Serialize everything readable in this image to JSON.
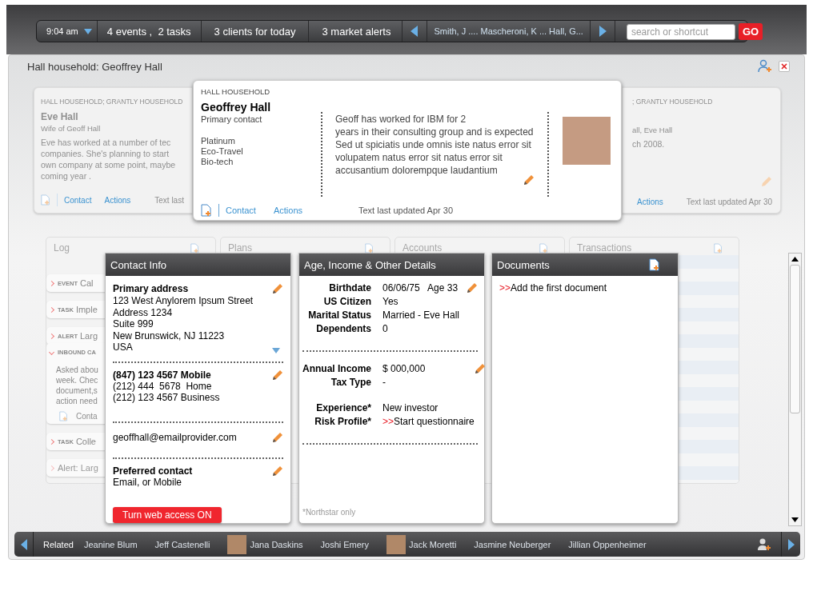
{
  "top_bar": {
    "time": "9:04 am",
    "items": [
      "4 events ,  2 tasks",
      "3 clients for today",
      "3 market alerts"
    ],
    "recent": "Smith, J .... Mascheroni, K ... Hall, G...",
    "search": {
      "placeholder": "search or shortcut"
    },
    "go": "GO"
  },
  "window": {
    "title": "Hall household: Geoffrey Hall"
  },
  "cards": [
    {
      "kind": "faded",
      "household": "HALL HOUSEHOLD; GRANTLY HOUSEHOLD",
      "name": "Eve Hall",
      "role": "Wife of Geoff Hall",
      "note": [
        "Eve has worked at a number of tec",
        "companies. She's planning to start",
        "own company at some point, maybe",
        "coming year ."
      ],
      "links": [
        "Contact",
        "Actions"
      ],
      "updated": "Text last"
    },
    {
      "kind": "focused",
      "household": "HALL HOUSEHOLD",
      "name": "Geoffrey Hall",
      "role": "Primary contact",
      "tags": [
        "Platinum",
        "Eco-Travel",
        "Bio-tech"
      ],
      "note": [
        "Geoff has worked for IBM for 2",
        "years in their consulting group and is expected",
        "Sed ut spiciatis unde omnis iste natus error sit",
        "volupatem natus error sit natus error sit",
        "accusantium dolorempque laudantium"
      ],
      "links": [
        "Contact",
        "Actions"
      ],
      "updated": "Text last updated Apr 30"
    },
    {
      "kind": "faded",
      "household": "; GRANTLY HOUSEHOLD",
      "role": "all, Eve Hall",
      "note": [
        "ch 2008."
      ],
      "links": [
        "Actions"
      ],
      "updated": "Text last updated Apr 30"
    }
  ],
  "panels": [
    {
      "title": "Log"
    },
    {
      "title": "Plans"
    },
    {
      "title": "Accounts"
    },
    {
      "title": "Transactions"
    }
  ],
  "log_items": [
    {
      "type": "EVENT",
      "text": "Cal",
      "expanded": false
    },
    {
      "type": "TASK",
      "text": "Imple",
      "expanded": false
    },
    {
      "type": "ALERT",
      "text": "Larg",
      "expanded": false
    },
    {
      "type": "INBOUND CA",
      "expanded": true,
      "body": [
        "Asked abou",
        "week. Chec",
        "document,s",
        "action need"
      ],
      "link": "Conta"
    },
    {
      "type": "TASK",
      "text": "Colle",
      "expanded": false
    },
    {
      "text": "Alert: Larg",
      "expanded": false
    }
  ],
  "contact_info": {
    "title": "Contact Info",
    "sections": [
      {
        "heading": "Primary address",
        "lines": [
          "123 West Anylorem Ipsum Street",
          "Address 1234",
          "Suite 999",
          "New Brunswick, NJ 11223",
          "USA"
        ],
        "kind": "address"
      },
      {
        "heading": "(847) 123 4567 Mobile",
        "lines": [
          "(212) 444  5678  Home",
          "(212) 123 4567 Business"
        ],
        "kind": "plain"
      },
      {
        "lines": [
          "geoffhall@emailprovider.com"
        ],
        "kind": "plain"
      },
      {
        "heading": "Preferred contact",
        "lines": [
          "Email, or Mobile"
        ],
        "kind": "plain"
      }
    ],
    "button": "Turn web access ON"
  },
  "details": {
    "title": "Age, Income & Other Details",
    "groups": [
      {
        "blocks": [
          [
            {
              "label": "Birthdate",
              "value": "06/06/75   Age 33"
            },
            {
              "label": "US Citizen",
              "value": "Yes"
            },
            {
              "label": "Marital Status",
              "value": "Married - Eve Hall"
            },
            {
              "label": "Dependents",
              "value": "0"
            }
          ]
        ]
      },
      {
        "blocks": [
          [
            {
              "label": "Annual Income",
              "value": "$ 000,000"
            },
            {
              "label": "Tax Type",
              "value": "-"
            }
          ],
          [
            {
              "label": "Experience*",
              "value": "New investor"
            },
            {
              "label": "Risk Profile*",
              "value": "Start questionnaire",
              "prefix": ">>"
            }
          ]
        ]
      }
    ],
    "note": "*Northstar only"
  },
  "documents": {
    "title": "Documents",
    "prefix": ">>",
    "link": "Add the first document"
  },
  "related": {
    "label": "Related",
    "people": [
      {
        "name": "Jeanine Blum",
        "photo": false
      },
      {
        "name": "Jeff Castenelli",
        "photo": false
      },
      {
        "name": "Jana Daskins",
        "photo": true
      },
      {
        "name": "Joshi Emery",
        "photo": false
      },
      {
        "name": "Jack Moretti",
        "photo": true
      },
      {
        "name": "Jasmine Neuberger",
        "photo": false
      },
      {
        "name": "Jillian Oppenheimer",
        "photo": false
      }
    ]
  }
}
